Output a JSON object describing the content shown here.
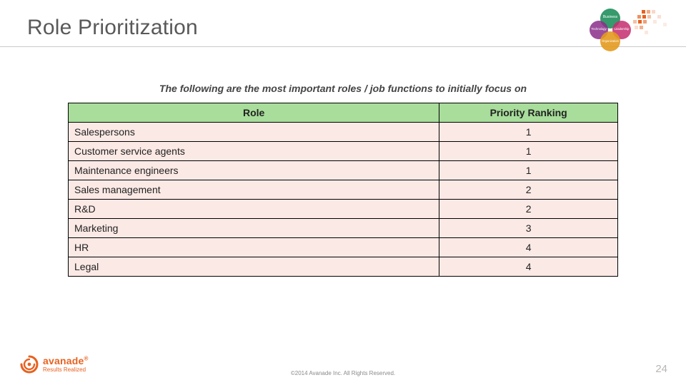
{
  "header": {
    "title": "Role Prioritization"
  },
  "subtitle": "The following are the most important roles / job functions to initially focus on",
  "table": {
    "headers": {
      "role": "Role",
      "rank": "Priority Ranking"
    },
    "rows": [
      {
        "role": "Salespersons",
        "rank": "1"
      },
      {
        "role": "Customer service agents",
        "rank": "1"
      },
      {
        "role": "Maintenance engineers",
        "rank": "1"
      },
      {
        "role": "Sales management",
        "rank": "2"
      },
      {
        "role": "R&D",
        "rank": "2"
      },
      {
        "role": "Marketing",
        "rank": "3"
      },
      {
        "role": "HR",
        "rank": "4"
      },
      {
        "role": "Legal",
        "rank": "4"
      }
    ]
  },
  "footer": {
    "brand": "avanade",
    "reg": "®",
    "tagline": "Results Realized",
    "copyright": "©2014 Avanade Inc. All Rights Reserved.",
    "page": "24"
  },
  "corner": {
    "bubbles": [
      {
        "label": "Business",
        "color": "#1f8f5c"
      },
      {
        "label": "Technology",
        "color": "#8a2e8a"
      },
      {
        "label": "Leadership",
        "color": "#c42d6f"
      },
      {
        "label": "Organization",
        "color": "#e39a1e"
      }
    ]
  },
  "chart_data": {
    "type": "table",
    "title": "Role Prioritization",
    "columns": [
      "Role",
      "Priority Ranking"
    ],
    "rows": [
      [
        "Salespersons",
        1
      ],
      [
        "Customer service agents",
        1
      ],
      [
        "Maintenance engineers",
        1
      ],
      [
        "Sales management",
        2
      ],
      [
        "R&D",
        2
      ],
      [
        "Marketing",
        3
      ],
      [
        "HR",
        4
      ],
      [
        "Legal",
        4
      ]
    ]
  }
}
